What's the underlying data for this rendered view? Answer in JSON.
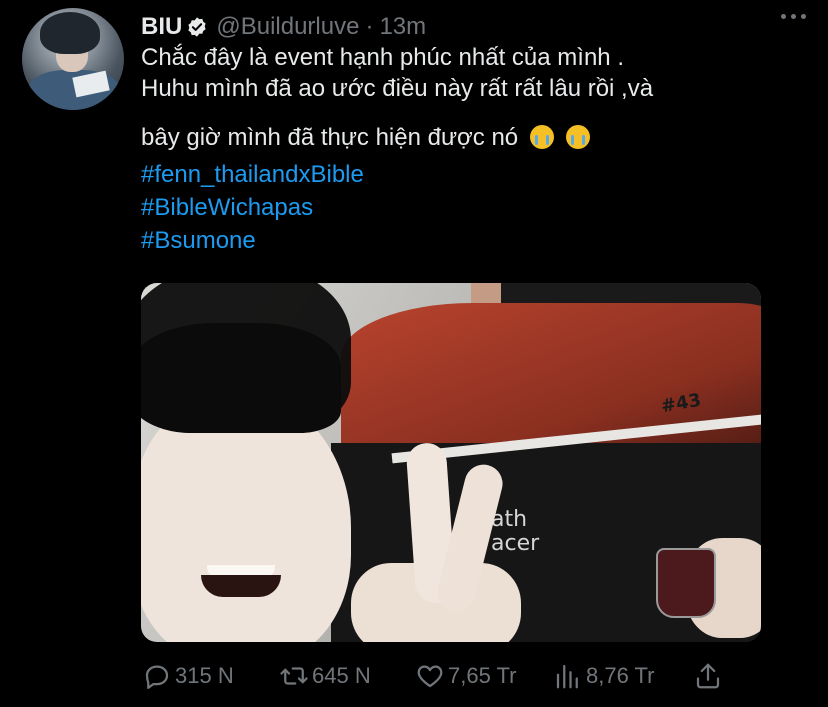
{
  "tweet": {
    "author_name": "BIU",
    "verified": true,
    "handle": "@Buildurluve",
    "separator": "·",
    "time": "13m",
    "text_lines": [
      "Chắc đây là event hạnh phúc nhất của mình .",
      "Huhu mình đã ao ước điều này rất rất lâu rồi ,và",
      "bây giờ mình đã thực hiện được nó"
    ],
    "emojis": [
      "loudly-crying-face",
      "loudly-crying-face"
    ],
    "hashtags": [
      "#fenn_thailandxBible",
      "#BibleWichapas",
      "#Bsumone"
    ],
    "media_text": [
      "#43",
      "ath",
      "acer"
    ]
  },
  "actions": {
    "replies": "315 N",
    "retweets": "645 N",
    "likes": "7,65 Tr",
    "views": "8,76 Tr"
  },
  "colors": {
    "background": "#000000",
    "text": "#e7e9ea",
    "muted": "#71767b",
    "link": "#1d9bf0"
  }
}
